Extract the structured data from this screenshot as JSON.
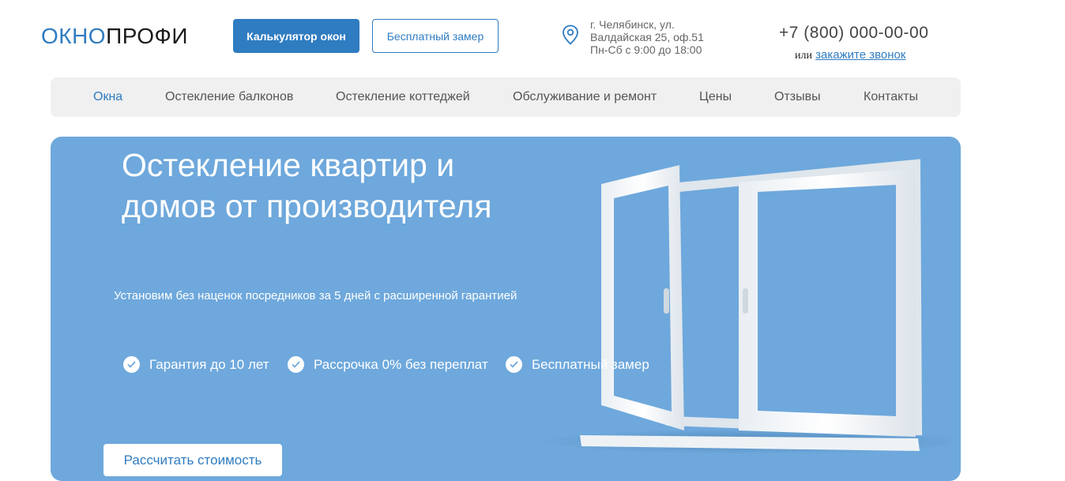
{
  "header": {
    "logo_part1": "ОКНО",
    "logo_part2": "ПРОФИ",
    "calc_button": "Калькулятор окон",
    "measure_button": "Бесплатный замер",
    "address_line1": "г. Челябинск, ул.",
    "address_line2": "Валдайская 25, оф.51",
    "hours": "Пн-Сб с 9:00 до 18:00",
    "phone": "+7 (800) 000-00-00",
    "or_text": "или",
    "callback_link": "закажите звонок",
    "icons": {
      "location": "map-pin-icon"
    }
  },
  "nav": {
    "items": [
      {
        "label": "Окна"
      },
      {
        "label": "Остекление балконов"
      },
      {
        "label": "Остекление коттеджей"
      },
      {
        "label": "Обслуживание и ремонт"
      },
      {
        "label": "Цены"
      },
      {
        "label": "Отзывы"
      },
      {
        "label": "Контакты"
      }
    ]
  },
  "hero": {
    "title": "Остекление квартир и домов от производителя",
    "subtitle": "Установим без наценок посредников за 5 дней с расширенной гарантией",
    "features": [
      {
        "label": "Гарантия до 10 лет",
        "icon": "check-icon"
      },
      {
        "label": "Рассрочка 0% без переплат",
        "icon": "check-icon"
      },
      {
        "label": "Бесплатный замер",
        "icon": "check-icon"
      }
    ],
    "cta": "Рассчитать стоимость"
  },
  "colors": {
    "accent": "#2f7cc1",
    "hero_bg": "#6ea8dc",
    "nav_bg": "#f0f0f0"
  }
}
